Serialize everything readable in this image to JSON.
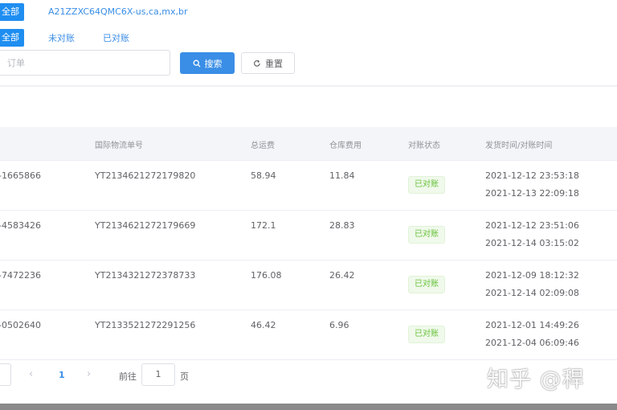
{
  "top": {
    "store_tag": "全部",
    "store_name": "A21ZZXC64QMC6X-us,ca,mx,br",
    "filters": [
      {
        "label": "全部",
        "active": true
      },
      {
        "label": "未对账",
        "active": false
      },
      {
        "label": "已对账",
        "active": false
      }
    ],
    "order_placeholder": "订单",
    "search_label": "搜索",
    "reset_label": "重置"
  },
  "table": {
    "columns": [
      "国际物流单号",
      "总运费",
      "仓库费用",
      "对账状态",
      "发货时间/对账时间"
    ],
    "rows": [
      {
        "order": "-1665866",
        "tracking": "YT2134621272179820",
        "freight": "58.94",
        "warehouse": "11.84",
        "status": "已对账",
        "ship_time": "2021-12-12 23:53:18",
        "reconcile_time": "2021-12-13 22:09:18"
      },
      {
        "order": "-4583426",
        "tracking": "YT2134621272179669",
        "freight": "172.1",
        "warehouse": "28.83",
        "status": "已对账",
        "ship_time": "2021-12-12 23:51:06",
        "reconcile_time": "2021-12-14 03:15:02"
      },
      {
        "order": "-7472236",
        "tracking": "YT2134321272378733",
        "freight": "176.08",
        "warehouse": "26.42",
        "status": "已对账",
        "ship_time": "2021-12-09 18:12:32",
        "reconcile_time": "2021-12-14 02:09:08"
      },
      {
        "order": "-0502640",
        "tracking": "YT2133521272291256",
        "freight": "46.42",
        "warehouse": "6.96",
        "status": "已对账",
        "ship_time": "2021-12-01 14:49:26",
        "reconcile_time": "2021-12-04 06:09:46"
      }
    ]
  },
  "pagination": {
    "prev_icon": "chevron-left-icon",
    "next_icon": "chevron-right-icon",
    "current_page": "1",
    "goto_label": "前往",
    "goto_value": "1",
    "page_unit": "页"
  },
  "watermark": "知乎 @稈",
  "colors": {
    "primary": "#3a8ee6",
    "success": "#67c23a",
    "header_bg": "#f3f5f8"
  }
}
